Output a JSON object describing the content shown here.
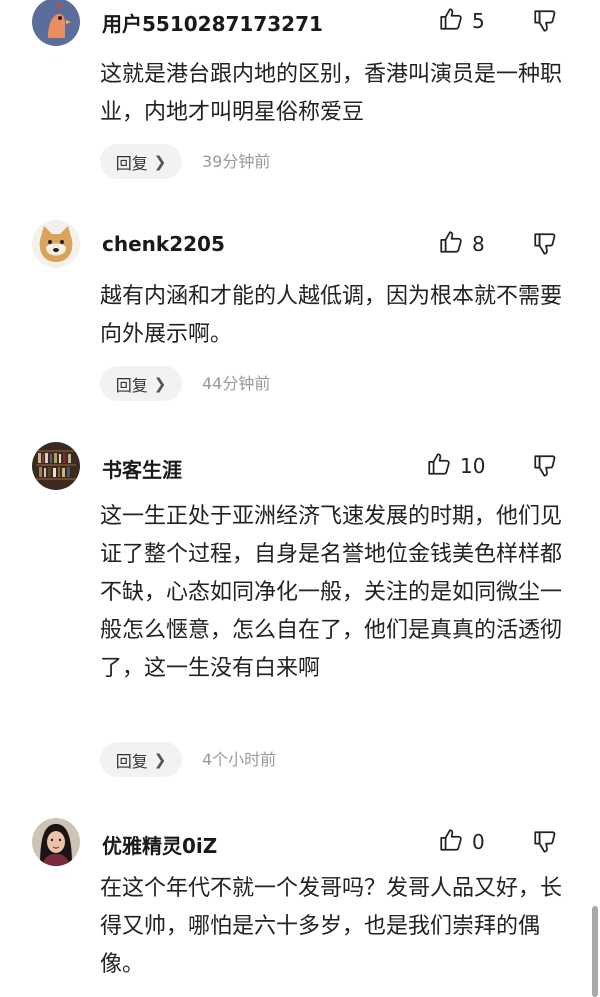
{
  "comments": [
    {
      "username": "用户5510287173271",
      "likes": "5",
      "text": "这就是港台跟内地的区别，香港叫演员是一种职业，内地才叫明星俗称爱豆",
      "reply_label": "回复",
      "time": "39分钟前",
      "avatar_icon": "rooster-avatar-icon"
    },
    {
      "username": "chenk2205",
      "likes": "8",
      "text": "越有内涵和才能的人越低调，因为根本就不需要向外展示啊。",
      "reply_label": "回复",
      "time": "44分钟前",
      "avatar_icon": "shiba-dog-avatar-icon"
    },
    {
      "username": "书客生涯",
      "likes": "10",
      "text": "这一生正处于亚洲经济飞速发展的时期，他们见证了整个过程，自身是名誉地位金钱美色样样都不缺，心态如同净化一般，关注的是如同微尘一般怎么惬意，怎么自在了，他们是真真的活透彻了，这一生没有白来啊",
      "reply_label": "回复",
      "time": "4个小时前",
      "avatar_icon": "bookshelf-avatar-icon"
    },
    {
      "username": "优雅精灵0iZ",
      "likes": "0",
      "text": "在这个年代不就一个发哥吗？发哥人品又好，长得又帅，哪怕是六十多岁，也是我们崇拜的偶像。",
      "avatar_icon": "woman-portrait-avatar-icon"
    }
  ],
  "icons": {
    "like": "thumbs-up-icon",
    "dislike": "thumbs-down-icon",
    "reply_arrow": "chevron-right-icon"
  },
  "colors": {
    "time_gray": "#9a9a9a",
    "reply_bg": "#f2f2f2"
  }
}
